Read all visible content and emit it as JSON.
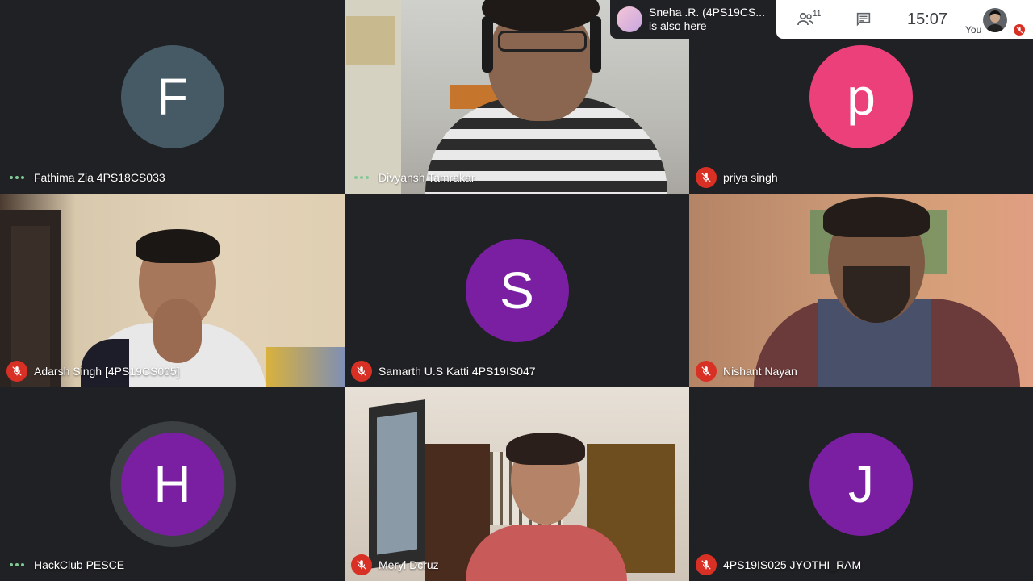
{
  "colors": {
    "background": "#202124",
    "mic_off": "#d93025",
    "speaking_dots": "#81c995",
    "avatar_f": "#455a64",
    "avatar_p": "#ec407a",
    "avatar_s": "#7b1fa2",
    "avatar_h": "#7b1fa2",
    "avatar_j": "#7b1fa2"
  },
  "toast": {
    "name": "Sneha .R. (4PS19CS...",
    "message": "is also here"
  },
  "controls": {
    "participants_icon": "people-icon",
    "participants_count": "11",
    "chat_icon": "chat-icon",
    "time": "15:07",
    "self_label": "You"
  },
  "tiles": [
    {
      "name": "Fathima Zia 4PS18CS033",
      "status": "speaking",
      "avatar_letter": "F"
    },
    {
      "name": "Divyansh Tamrakar",
      "status": "speaking",
      "video": true
    },
    {
      "name": "priya singh",
      "status": "muted",
      "avatar_letter": "p"
    },
    {
      "name": "Adarsh Singh [4PS19CS005]",
      "status": "muted",
      "video": true
    },
    {
      "name": "Samarth U.S Katti 4PS19IS047",
      "status": "muted",
      "avatar_letter": "S"
    },
    {
      "name": "Nishant Nayan",
      "status": "muted",
      "video": true
    },
    {
      "name": "HackClub PESCE",
      "status": "speaking",
      "avatar_letter": "H"
    },
    {
      "name": "Meryl Dcruz",
      "status": "muted",
      "video": true
    },
    {
      "name": "4PS19IS025 JYOTHI_RAM",
      "status": "muted",
      "avatar_letter": "J"
    }
  ]
}
